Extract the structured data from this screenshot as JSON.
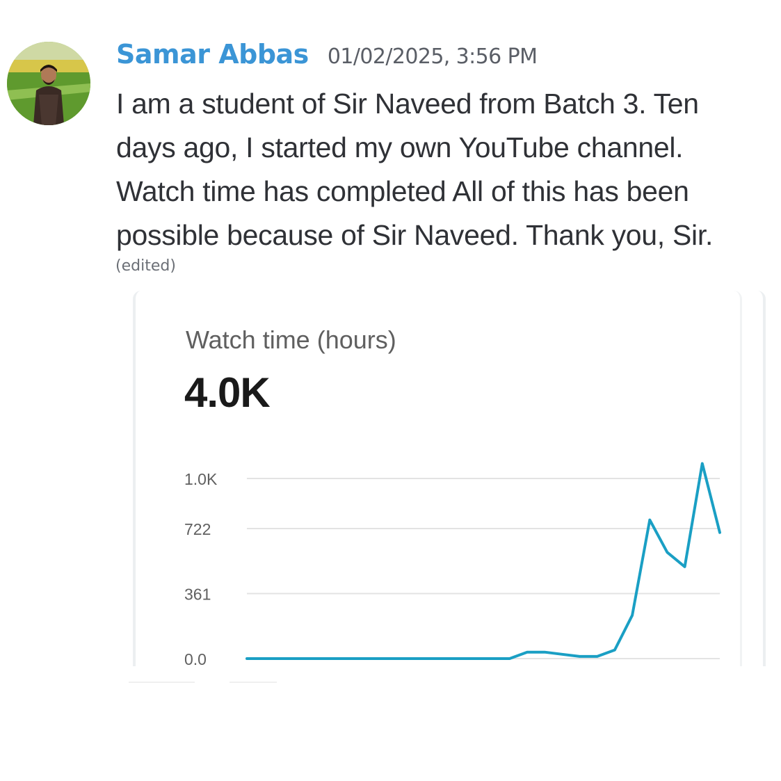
{
  "message": {
    "author": "Samar Abbas",
    "timestamp": "01/02/2025, 3:56 PM",
    "lines": [
      "I am a student of Sir Naveed from Batch 3. Ten",
      "days ago, I started my own YouTube channel.",
      "Watch time has completed  All of this has been",
      "possible because of Sir Naveed. Thank you, Sir."
    ],
    "edited_label": "(edited)"
  },
  "card": {
    "title": "Watch time (hours)",
    "total": "4.0K"
  },
  "chart_data": {
    "type": "line",
    "title": "Watch time (hours)",
    "yticks": [
      "1.0K",
      "722",
      "361",
      "0.0"
    ],
    "ytick_values": [
      1000,
      722,
      361,
      0
    ],
    "ylim": [
      0,
      1083
    ],
    "grid": true,
    "line_color": "#1a9fc4",
    "series": [
      {
        "values": [
          0,
          0,
          0,
          0,
          0,
          0,
          0,
          0,
          0,
          0,
          0,
          0,
          0,
          0,
          0,
          0,
          36,
          36,
          24,
          12,
          12,
          48,
          240,
          770,
          590,
          510,
          1083,
          700
        ]
      }
    ]
  }
}
